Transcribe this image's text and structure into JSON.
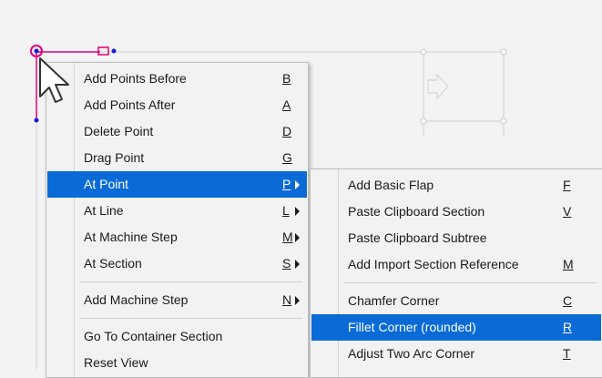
{
  "menu": {
    "items": [
      {
        "label": "Add Points Before",
        "shortcut": "B"
      },
      {
        "label": "Add Points After",
        "shortcut": "A"
      },
      {
        "label": "Delete Point",
        "shortcut": "D"
      },
      {
        "label": "Drag Point",
        "shortcut": "G"
      },
      {
        "label": "At Point",
        "shortcut": "P"
      },
      {
        "label": "At Line",
        "shortcut": "L"
      },
      {
        "label": "At Machine Step",
        "shortcut": "M"
      },
      {
        "label": "At Section",
        "shortcut": "S"
      },
      {
        "label": "Add Machine Step",
        "shortcut": "N"
      },
      {
        "label": "Go To Container Section"
      },
      {
        "label": "Reset View"
      }
    ]
  },
  "submenu": {
    "items": [
      {
        "label": "Add Basic Flap",
        "shortcut": "F"
      },
      {
        "label": "Paste Clipboard Section",
        "shortcut": "V"
      },
      {
        "label": "Paste Clipboard Subtree"
      },
      {
        "label": "Add Import Section Reference",
        "shortcut": "M"
      },
      {
        "label": "Chamfer Corner",
        "shortcut": "C"
      },
      {
        "label": "Fillet Corner (rounded)",
        "shortcut": "R"
      },
      {
        "label": "Adjust Two Arc Corner",
        "shortcut": "T"
      }
    ]
  },
  "colors": {
    "highlight": "#0a6ad6",
    "selection": "#e0007f",
    "point": "#1a1ad6"
  }
}
